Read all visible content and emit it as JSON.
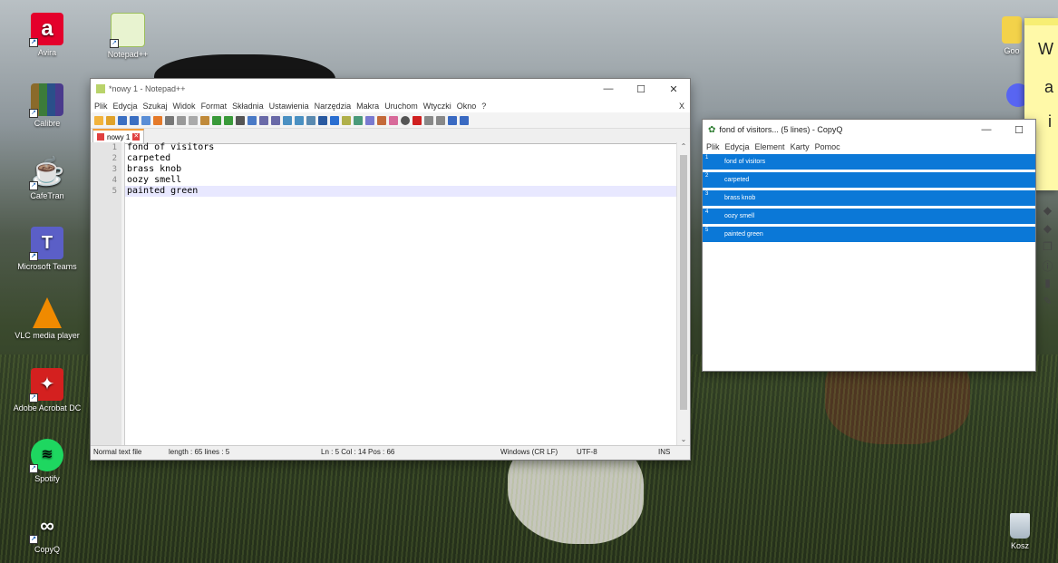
{
  "desktop": {
    "icons_left": [
      {
        "label": "Avira",
        "icon": "avira-icon",
        "color": "#e4002b"
      },
      {
        "label": "Calibre",
        "icon": "calibre-icon",
        "color": "#4a3a8c"
      },
      {
        "label": "CafeTran",
        "icon": "cafetran-icon",
        "color": "#d9201f"
      },
      {
        "label": "Microsoft Teams",
        "icon": "teams-icon",
        "color": "#5b5fc7"
      },
      {
        "label": "VLC media player",
        "icon": "vlc-icon",
        "color": "#f08a00"
      },
      {
        "label": "Adobe Acrobat DC",
        "icon": "acrobat-icon",
        "color": "#d4201f"
      },
      {
        "label": "Spotify",
        "icon": "spotify-icon",
        "color": "#1ed760"
      },
      {
        "label": "CopyQ",
        "icon": "copyq-icon",
        "color": "#2e7d32"
      }
    ],
    "icon_notepadpp": {
      "label": "Notepad++",
      "icon": "notepadpp-icon"
    },
    "icon_trash": {
      "label": "Kosz",
      "icon": "recycle-bin-icon"
    },
    "icon_partial_top_right": {
      "label": "Goo",
      "icon": "app-icon"
    }
  },
  "notepad": {
    "title": "*nowy 1 - Notepad++",
    "menu": [
      "Plik",
      "Edycja",
      "Szukaj",
      "Widok",
      "Format",
      "Składnia",
      "Ustawienia",
      "Narzędzia",
      "Makra",
      "Uruchom",
      "Wtyczki",
      "Okno",
      "?"
    ],
    "menu_close": "X",
    "tab_label": "nowy 1",
    "lines": [
      {
        "num": "1",
        "text": "fond of visitors"
      },
      {
        "num": "2",
        "text": "carpeted"
      },
      {
        "num": "3",
        "text": "brass knob"
      },
      {
        "num": "4",
        "text": "oozy smell"
      },
      {
        "num": "5",
        "text": "painted green"
      }
    ],
    "status": {
      "type": "Normal text file",
      "length": "length : 65    lines : 5",
      "position": "Ln : 5    Col : 14    Pos : 66",
      "eol": "Windows (CR LF)",
      "encoding": "UTF-8",
      "mode": "INS"
    }
  },
  "copyq": {
    "title": "fond of visitors... (5 lines) - CopyQ",
    "menu": [
      "Plik",
      "Edycja",
      "Element",
      "Karty",
      "Pomoc"
    ],
    "items": [
      {
        "num": "1",
        "text": "fond of visitors"
      },
      {
        "num": "2",
        "text": "carpeted"
      },
      {
        "num": "3",
        "text": "brass knob"
      },
      {
        "num": "4",
        "text": "oozy smell"
      },
      {
        "num": "5",
        "text": "painted green"
      }
    ],
    "selection_color": "#0b78d7"
  },
  "sticky_note": {
    "lines": [
      "W",
      "a",
      "i"
    ]
  },
  "window_buttons": {
    "minimize": "—",
    "maximize": "☐",
    "close": "✕"
  }
}
